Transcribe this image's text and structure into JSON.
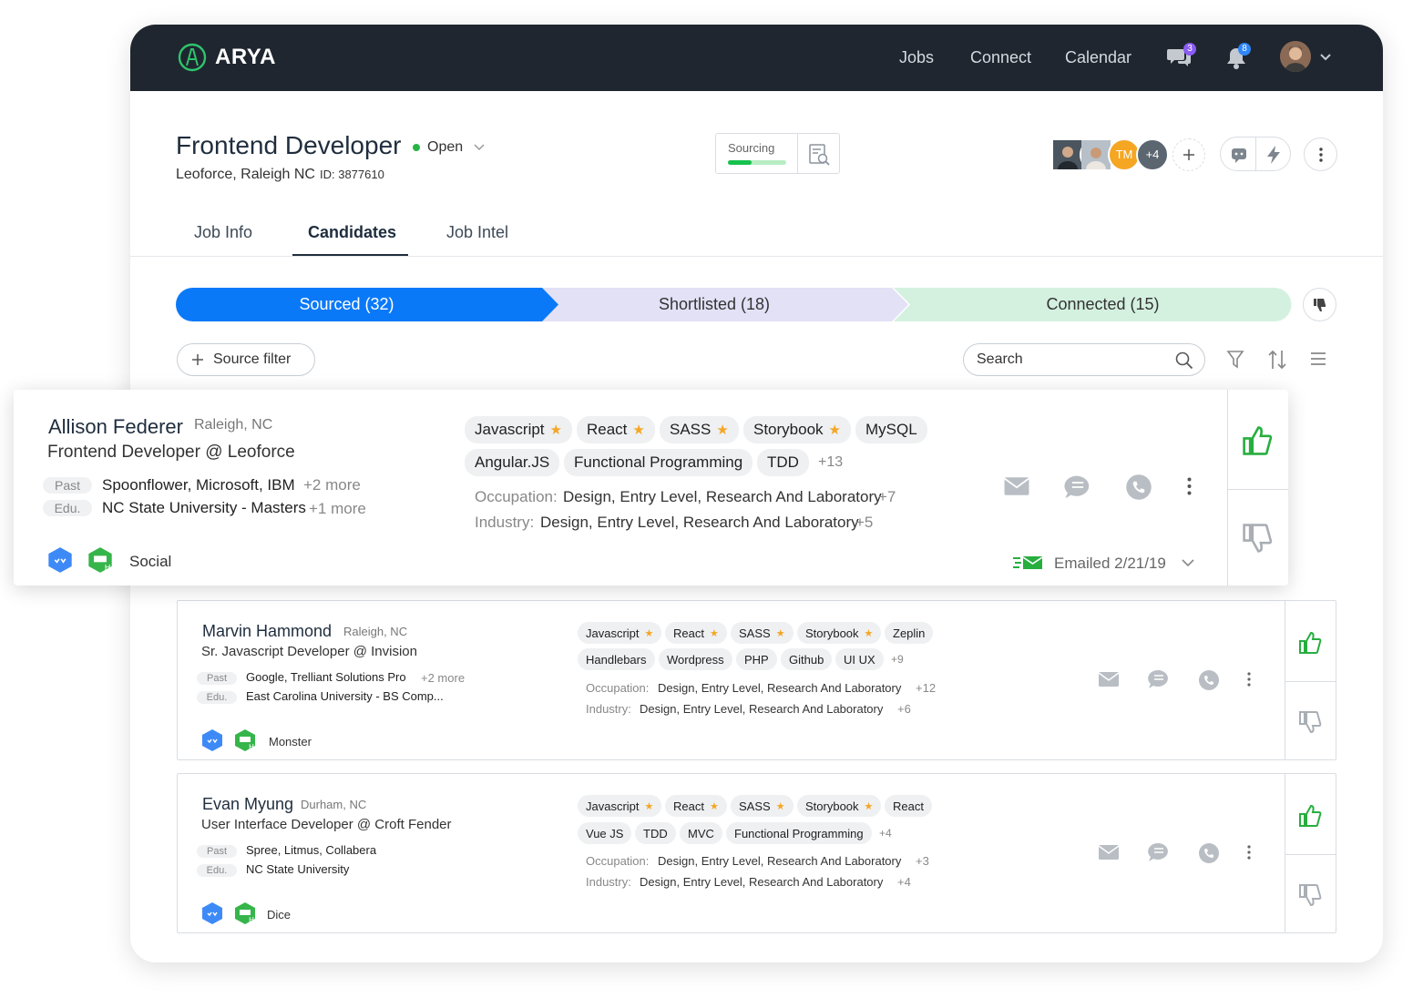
{
  "app": {
    "name": "ARYA"
  },
  "nav": {
    "jobs": "Jobs",
    "connect": "Connect",
    "calendar": "Calendar",
    "messages_badge": "3",
    "notifications_badge": "8"
  },
  "job": {
    "title": "Frontend Developer",
    "status": "Open",
    "location": "Leoforce, Raleigh NC",
    "id": "ID: 3877610",
    "sourcing_label": "Sourcing",
    "sourcing_progress": 0.4
  },
  "team": {
    "initials": "TM",
    "extra": "+4"
  },
  "tabs": [
    "Job Info",
    "Candidates",
    "Job Intel"
  ],
  "pipeline": {
    "sourced": "Sourced (32)",
    "shortlisted": "Shortlisted (18)",
    "connected": "Connected (15)"
  },
  "toolbar": {
    "source_filter": "Source filter",
    "search_placeholder": "Search"
  },
  "colors": {
    "topbar": "#1f2630",
    "sourced": "#0a79f8",
    "shortlisted": "#e2e1f6",
    "connected": "#d4f1e0",
    "thumb_up": "#27ae3f",
    "star": "#f5a623"
  },
  "candidates": [
    {
      "name": "Allison Federer",
      "location": "Raleigh, NC",
      "role": "Frontend Developer @ Leoforce",
      "past_label": "Past",
      "past": "Spoonflower, Microsoft, IBM",
      "past_more": "+2 more",
      "edu_label": "Edu.",
      "edu": "NC State University - Masters",
      "edu_more": "+1 more",
      "tags_row1": [
        "Javascript",
        "React",
        "SASS",
        "Storybook",
        "MySQL"
      ],
      "tags_row2": [
        "Angular.JS",
        "Functional Programming",
        "TDD"
      ],
      "tags_more": "+13",
      "occupation_label": "Occupation:",
      "occupation": "Design, Entry Level, Research And Laboratory",
      "occupation_more": "+7",
      "industry_label": "Industry:",
      "industry": "Design, Entry Level, Research And Laboratory",
      "industry_more": "+5",
      "source": "Social",
      "emailed": "Emailed 2/21/19"
    },
    {
      "name": "Marvin Hammond",
      "location": "Raleigh, NC",
      "role": "Sr. Javascript Developer @ Invision",
      "past_label": "Past",
      "past": "Google, Trelliant Solutions Pro",
      "past_more": "+2 more",
      "edu_label": "Edu.",
      "edu": "East Carolina University - BS Comp...",
      "tags_row1": [
        "Javascript",
        "React",
        "SASS",
        "Storybook",
        "Zeplin"
      ],
      "tags_row2": [
        "Handlebars",
        "Wordpress",
        "PHP",
        "Github",
        "UI UX"
      ],
      "tags_more": "+9",
      "occupation_label": "Occupation:",
      "occupation": "Design, Entry Level, Research And Laboratory",
      "occupation_more": "+12",
      "industry_label": "Industry:",
      "industry": "Design, Entry Level, Research And Laboratory",
      "industry_more": "+6",
      "source": "Monster"
    },
    {
      "name": "Evan Myung",
      "location": "Durham, NC",
      "role": "User Interface Developer @ Croft Fender",
      "past_label": "Past",
      "past": "Spree, Litmus, Collabera",
      "edu_label": "Edu.",
      "edu": "NC State University",
      "tags_row1": [
        "Javascript",
        "React",
        "SASS",
        "Storybook",
        "React"
      ],
      "tags_row2": [
        "Vue JS",
        "TDD",
        "MVC",
        "Functional Programming"
      ],
      "tags_more": "+4",
      "occupation_label": "Occupation:",
      "occupation": "Design, Entry Level, Research And Laboratory",
      "occupation_more": "+3",
      "industry_label": "Industry:",
      "industry": "Design, Entry Level, Research And Laboratory",
      "industry_more": "+4",
      "source": "Dice"
    }
  ]
}
